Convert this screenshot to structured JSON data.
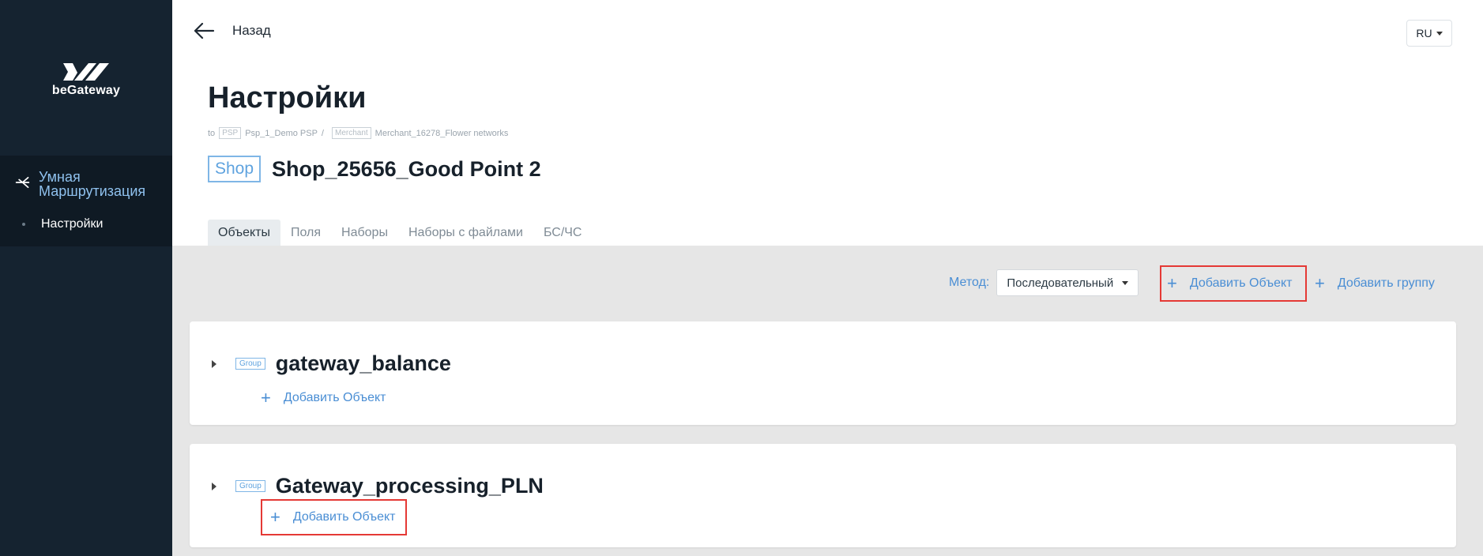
{
  "brand": {
    "name": "beGateway"
  },
  "sidebar": {
    "section_label": "Умная Маршрутизация",
    "items": [
      {
        "label": "Настройки"
      }
    ]
  },
  "header": {
    "back_label": "Назад",
    "lang": "RU",
    "title": "Настройки",
    "path": {
      "prefix": "to",
      "psp_tag": "PSP",
      "psp_name": "Psp_1_Demo PSP",
      "separator": "/",
      "merchant_tag": "Merchant",
      "merchant_name": "Merchant_16278_Flower networks"
    },
    "shop_tag": "Shop",
    "shop_name": "Shop_25656_Good Point 2"
  },
  "tabs": [
    {
      "label": "Объекты",
      "active": true
    },
    {
      "label": "Поля"
    },
    {
      "label": "Наборы"
    },
    {
      "label": "Наборы с файлами"
    },
    {
      "label": "БС/ЧС"
    }
  ],
  "toolbar": {
    "method_label": "Метод:",
    "method_value": "Последовательный",
    "add_object": "Добавить Объект",
    "add_group": "Добавить группу"
  },
  "groups": [
    {
      "tag": "Group",
      "name": "gateway_balance",
      "add_label": "Добавить Объект"
    },
    {
      "tag": "Group",
      "name": "Gateway_processing_PLN",
      "add_label": "Добавить Объект"
    }
  ],
  "colors": {
    "sidebar_bg": "#152330",
    "accent": "#4a8ed4",
    "highlight": "#e53935",
    "content_bg": "#e6e6e6"
  }
}
